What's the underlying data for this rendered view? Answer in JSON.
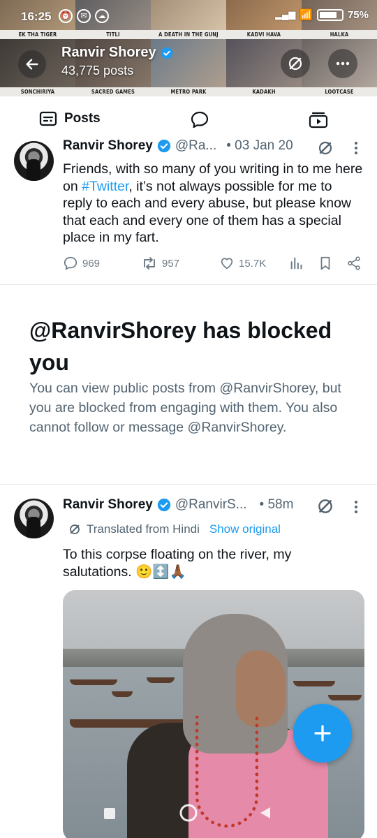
{
  "status_bar": {
    "time": "16:25",
    "battery": "75%"
  },
  "header": {
    "name": "Ranvir Shorey",
    "post_count": "43,775 posts",
    "tiles": [
      "EK THA TIGER",
      "TITLI",
      "A DEATH IN THE GUNJ",
      "KADVI HAVA",
      "HALKA",
      "SONCHIRIYA",
      "SACRED GAMES",
      "METRO PARK",
      "KADAKH",
      "LOOTCASE"
    ]
  },
  "tabs": {
    "posts_label": "Posts"
  },
  "tweet1": {
    "name": "Ranvir Shorey",
    "handle": "@Ra...",
    "time": "• 03 Jan 20",
    "text_before": "Friends, with so many of you writing in to me here on ",
    "hashtag": "#Twitter",
    "text_after": ", it’s not always possible for me to reply to each and every abuse, but please know that each and every one of them has a special place in my fart.",
    "replies": "969",
    "reposts": "957",
    "likes": "15.7K"
  },
  "blocked": {
    "title": "@RanvirShorey has blocked you",
    "description": "You can view public posts from @RanvirShorey, but you are blocked from engaging with them. You also cannot follow or message @RanvirShorey."
  },
  "tweet2": {
    "name": "Ranvir Shorey",
    "handle": "@RanvirS...",
    "time": "• 58m",
    "translated_label": "Translated from Hindi",
    "show_original": "Show original",
    "text": "To this corpse floating on the river, my salutations. 🙂↕️🙏🏾"
  },
  "colors": {
    "accent": "#1d9bf0",
    "text": "#0f1419",
    "muted": "#536471"
  }
}
